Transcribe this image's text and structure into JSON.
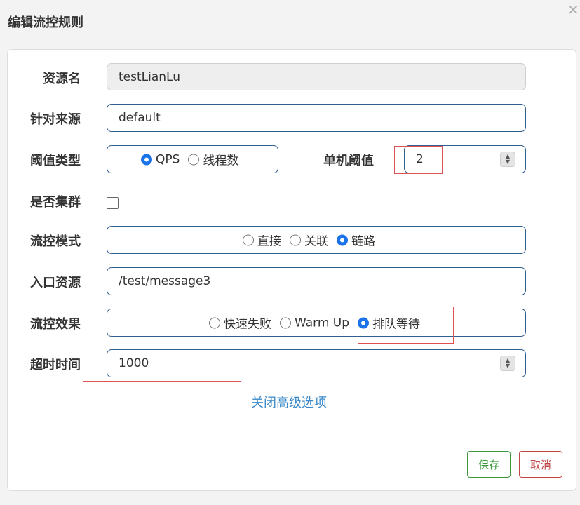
{
  "dialog": {
    "title": "编辑流控规则",
    "close_icon": "close-icon"
  },
  "form": {
    "resource": {
      "label": "资源名",
      "value": "testLianLu"
    },
    "origin": {
      "label": "针对来源",
      "value": "default"
    },
    "threshold_type": {
      "label": "阈值类型",
      "options": [
        "QPS",
        "线程数"
      ],
      "selected": "QPS"
    },
    "single_threshold": {
      "label": "单机阈值",
      "value": "2"
    },
    "cluster": {
      "label": "是否集群",
      "checked": false
    },
    "flow_mode": {
      "label": "流控模式",
      "options": [
        "直接",
        "关联",
        "链路"
      ],
      "selected": "链路"
    },
    "entry_resource": {
      "label": "入口资源",
      "value": "/test/message3"
    },
    "control_effect": {
      "label": "流控效果",
      "options": [
        "快速失败",
        "Warm Up",
        "排队等待"
      ],
      "selected": "排队等待"
    },
    "timeout": {
      "label": "超时时间",
      "value": "1000"
    }
  },
  "advanced_link": "关闭高级选项",
  "footer": {
    "save_label": "保存",
    "cancel_label": "取消"
  },
  "colors": {
    "accent": "#1a73e8",
    "save": "#3c9a3c",
    "cancel": "#c04545",
    "link": "#3a88c8",
    "annotation": "#e05050"
  }
}
